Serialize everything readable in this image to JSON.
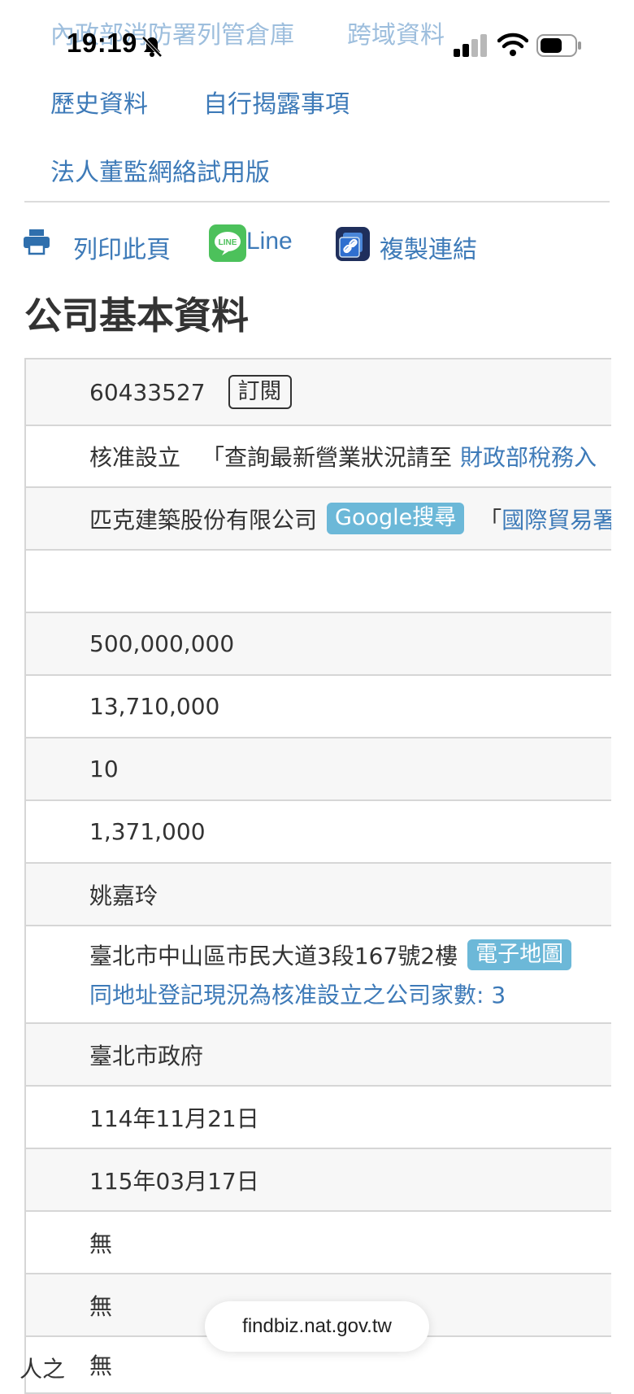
{
  "status_bar": {
    "time": "19:19"
  },
  "top_nav": {
    "row1": [
      "內政部消防署列管倉庫",
      "跨域資料"
    ],
    "row2": [
      "歷史資料",
      "自行揭露事項"
    ],
    "row3": [
      "法人董監網絡試用版"
    ]
  },
  "share_bar": {
    "print": "列印此頁",
    "line": "Line",
    "copy": "複製連結"
  },
  "page_title": "公司基本資料",
  "company": {
    "unified_no": "60433527",
    "subscribe_label": "訂閱",
    "status": "核准設立",
    "status_note_prefix": "「查詢最新營業狀況請至",
    "status_note_link": "財政部稅務入",
    "name": "匹克建築股份有限公司",
    "google_label": "Google搜尋",
    "trade_prefix": "「",
    "trade_link": "國際貿易署",
    "empty_row": "",
    "capital_total": "500,000,000",
    "capital_paid": "13,710,000",
    "par_value": "10",
    "issued_shares": "1,371,000",
    "representative": "姚嘉玲",
    "address": "臺北市中山區市民大道3段167號2樓",
    "map_label": "電子地圖",
    "same_address_note": "同地址登記現況為核准設立之公司家數: 3",
    "authority": "臺北市政府",
    "founded_date": "114年11月21日",
    "last_change_date": "115年03月17日",
    "row_none_1": "無",
    "row_none_2": "無",
    "row_none_3": "無",
    "left_fragment": "人之"
  },
  "browser": {
    "url": "findbiz.nat.gov.tw"
  },
  "colors": {
    "link": "#3d7ab8",
    "badge_blue": "#6cb8d8",
    "line_green": "#4cc15b"
  }
}
